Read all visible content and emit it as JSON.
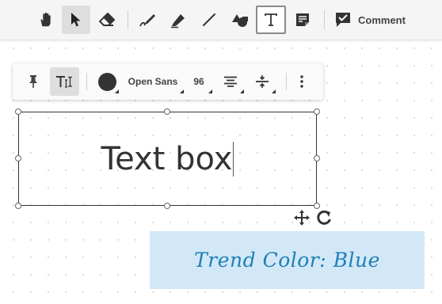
{
  "toolbar": {
    "tools": [
      {
        "name": "hand-icon",
        "active": false
      },
      {
        "name": "pointer-icon",
        "active": true
      },
      {
        "name": "eraser-icon",
        "active": false
      },
      {
        "name": "pen-icon",
        "active": false
      },
      {
        "name": "highlighter-icon",
        "active": false
      },
      {
        "name": "line-icon",
        "active": false
      },
      {
        "name": "shapes-icon",
        "active": false
      },
      {
        "name": "text-tool-icon",
        "active": true
      },
      {
        "name": "sticky-note-icon",
        "active": false
      }
    ],
    "comment_label": "Comment"
  },
  "format_bar": {
    "font": "Open Sans",
    "size": "96",
    "color": "#333333"
  },
  "textbox": {
    "text": "Text box"
  },
  "sticky_note": {
    "text": "Trend Color: Blue",
    "background": "#d2e8f7",
    "text_color": "#1f7fb6"
  }
}
